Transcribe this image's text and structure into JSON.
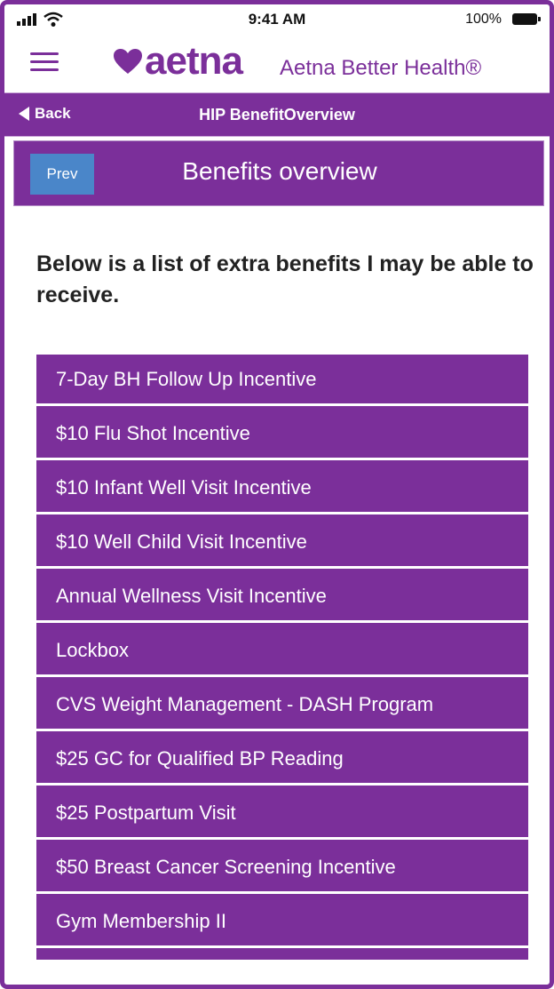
{
  "status_bar": {
    "time": "9:41 AM",
    "battery": "100%"
  },
  "header": {
    "logo_text": "aetna",
    "brand_sub": "Aetna Better Health®"
  },
  "nav": {
    "back_label": "Back",
    "title": "HIP BenefitOverview"
  },
  "banner": {
    "prev_label": "Prev",
    "title": "Benefits overview"
  },
  "intro_text": "Below is a list of extra benefits I may be able to receive.",
  "benefits": [
    "7-Day BH Follow Up Incentive",
    "$10 Flu Shot Incentive",
    "$10 Infant Well Visit Incentive",
    "$10 Well Child Visit Incentive",
    "Annual Wellness Visit Incentive",
    "Lockbox",
    "CVS Weight Management - DASH Program",
    "$25 GC for Qualified BP Reading",
    "$25 Postpartum Visit",
    "$50 Breast Cancer Screening Incentive",
    "Gym Membership II"
  ],
  "colors": {
    "brand_purple": "#7b2f9a",
    "prev_button_blue": "#4a86c9"
  }
}
